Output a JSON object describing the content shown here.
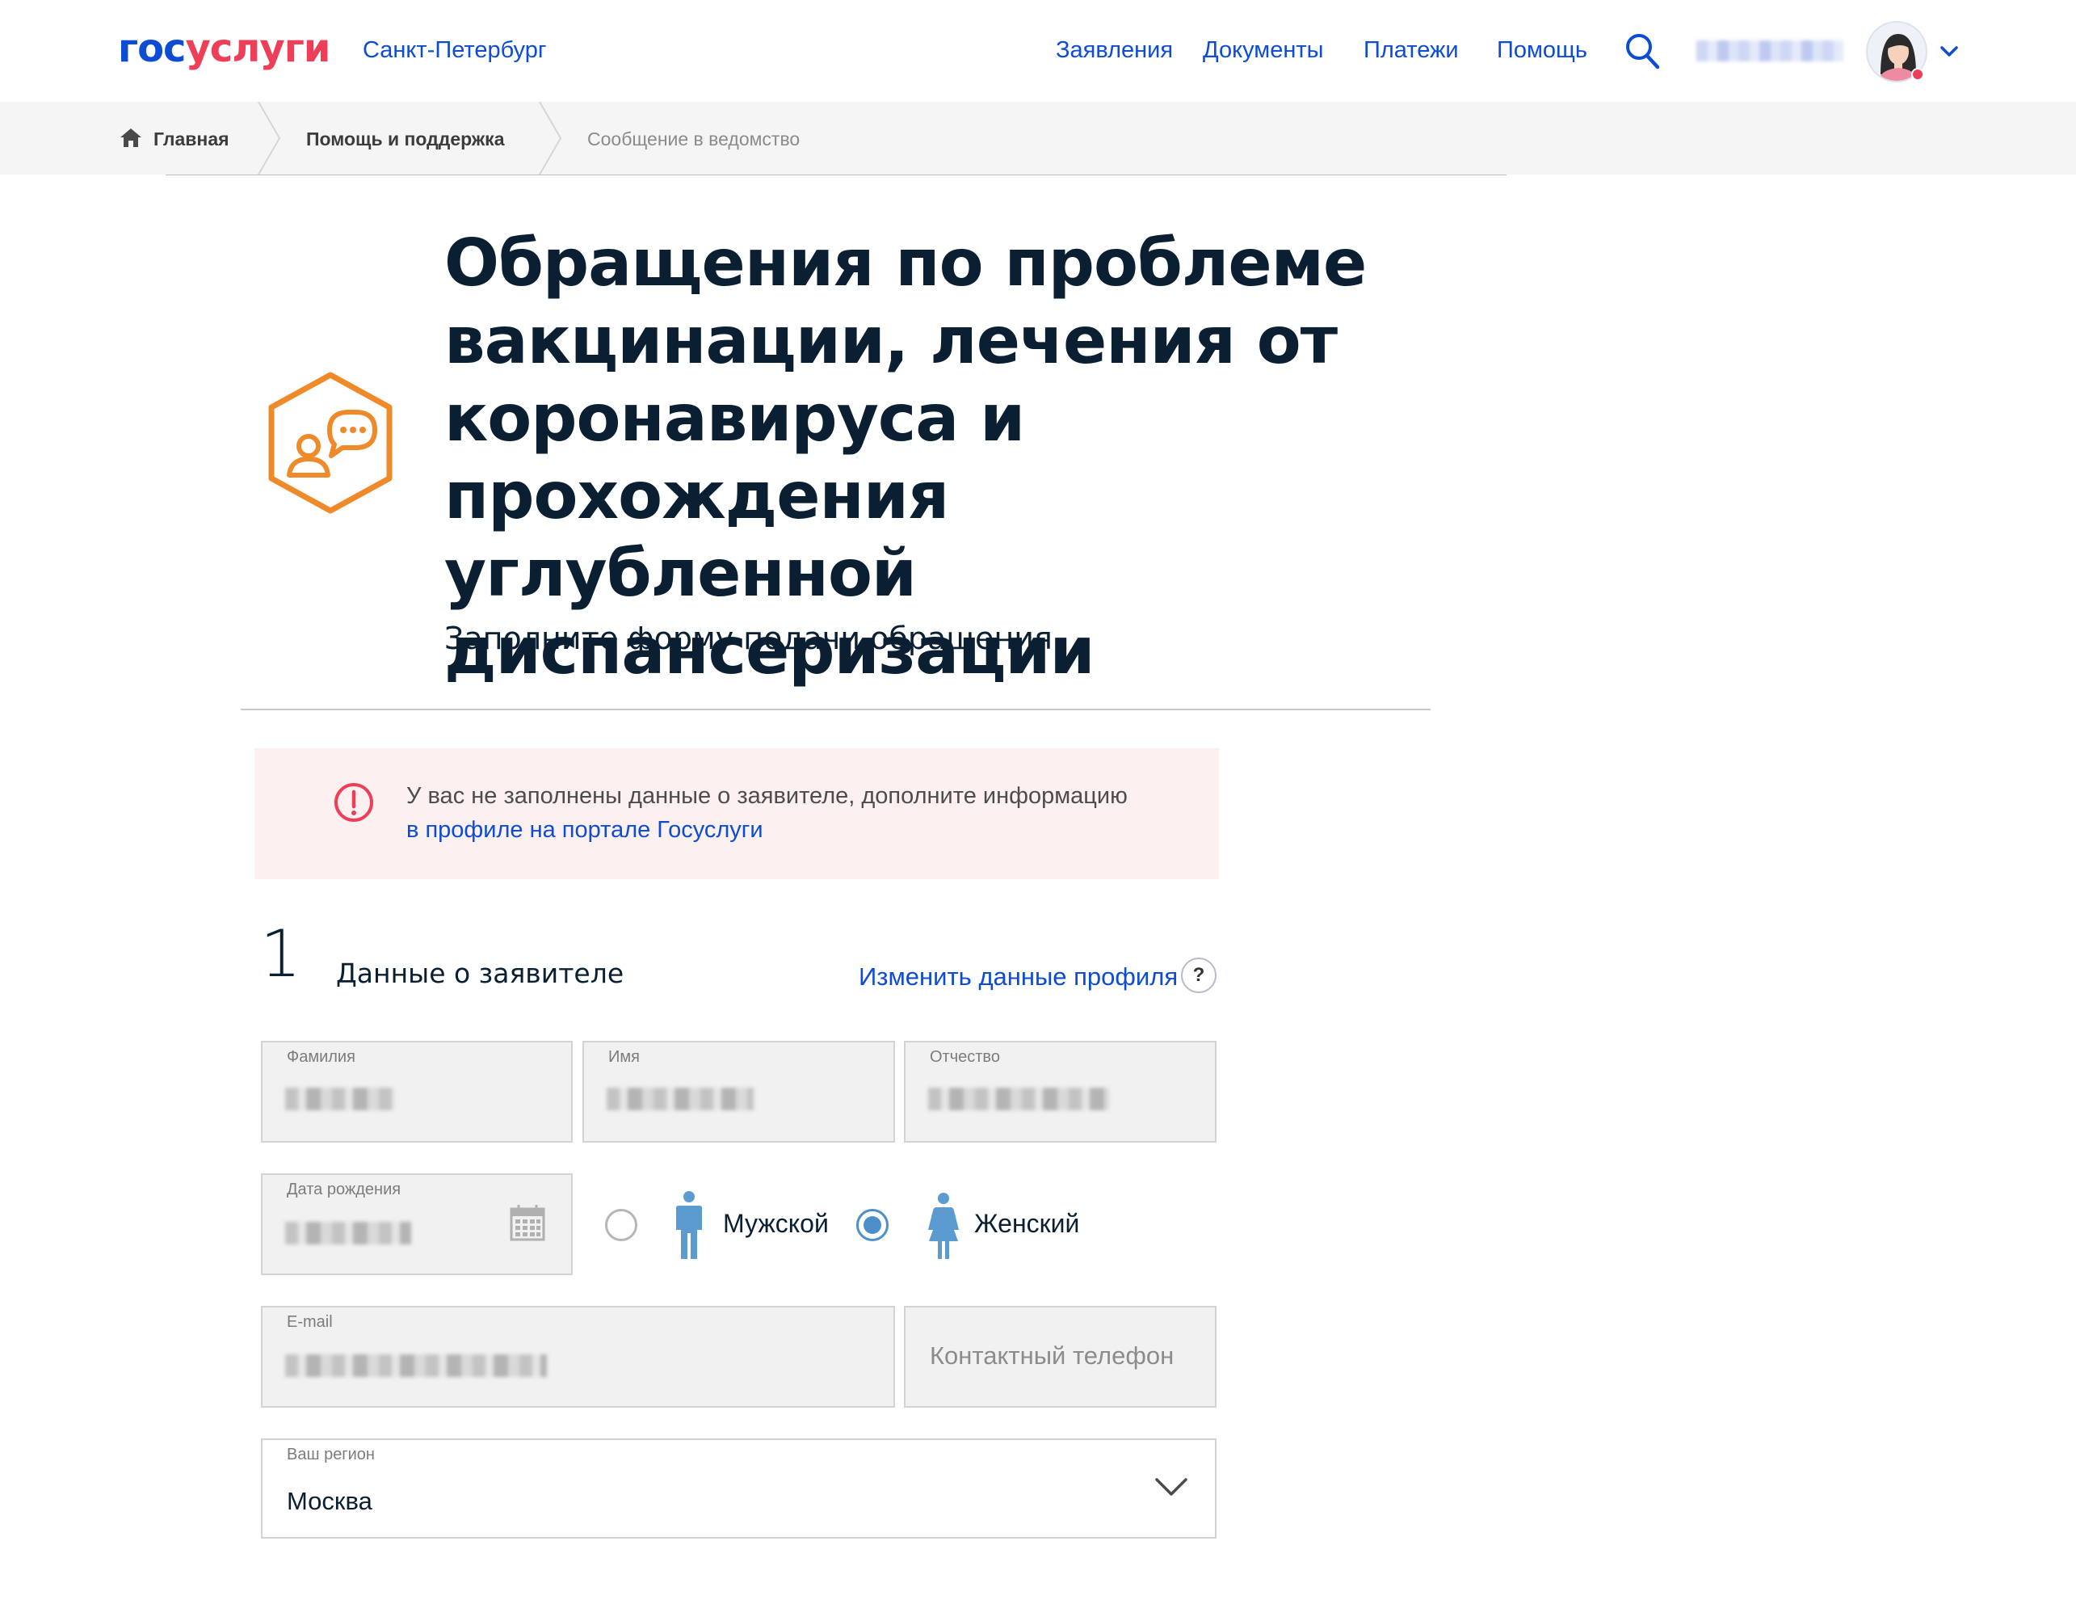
{
  "header": {
    "logo_part1": "гос",
    "logo_part2": "услуги",
    "city": "Санкт-Петербург",
    "nav": [
      "Заявления",
      "Документы",
      "Платежи",
      "Помощь"
    ],
    "brand_color": "#0d4cd3",
    "accent_color": "#ee3f58"
  },
  "breadcrumb": {
    "items": [
      "Главная",
      "Помощь и поддержка",
      "Сообщение в ведомство"
    ]
  },
  "page": {
    "title": "Обращения по проблеме вакцинации, лечения от коронавируса и прохождения углубленной диспансеризации",
    "subtitle": "Заполните форму подачи обращения",
    "icon": "chat-user-icon",
    "icon_color": "#ef8a2b"
  },
  "alert": {
    "text": "У вас не заполнены данные о заявителе, дополните информацию",
    "link": "в профиле на портале Госуслуги",
    "icon": "exclamation-circle-icon",
    "color": "#ee3f58"
  },
  "step": {
    "number": "1",
    "title": "Данные о заявителе",
    "edit_link": "Изменить данные профиля",
    "help": "?"
  },
  "form": {
    "last_name_label": "Фамилия",
    "first_name_label": "Имя",
    "middle_name_label": "Отчество",
    "birth_date_label": "Дата рождения",
    "email_label": "E-mail",
    "phone_placeholder": "Контактный телефон",
    "gender": {
      "male": "Мужской",
      "female": "Женский",
      "selected": "female"
    },
    "region_label": "Ваш регион",
    "region_value": "Москва"
  }
}
